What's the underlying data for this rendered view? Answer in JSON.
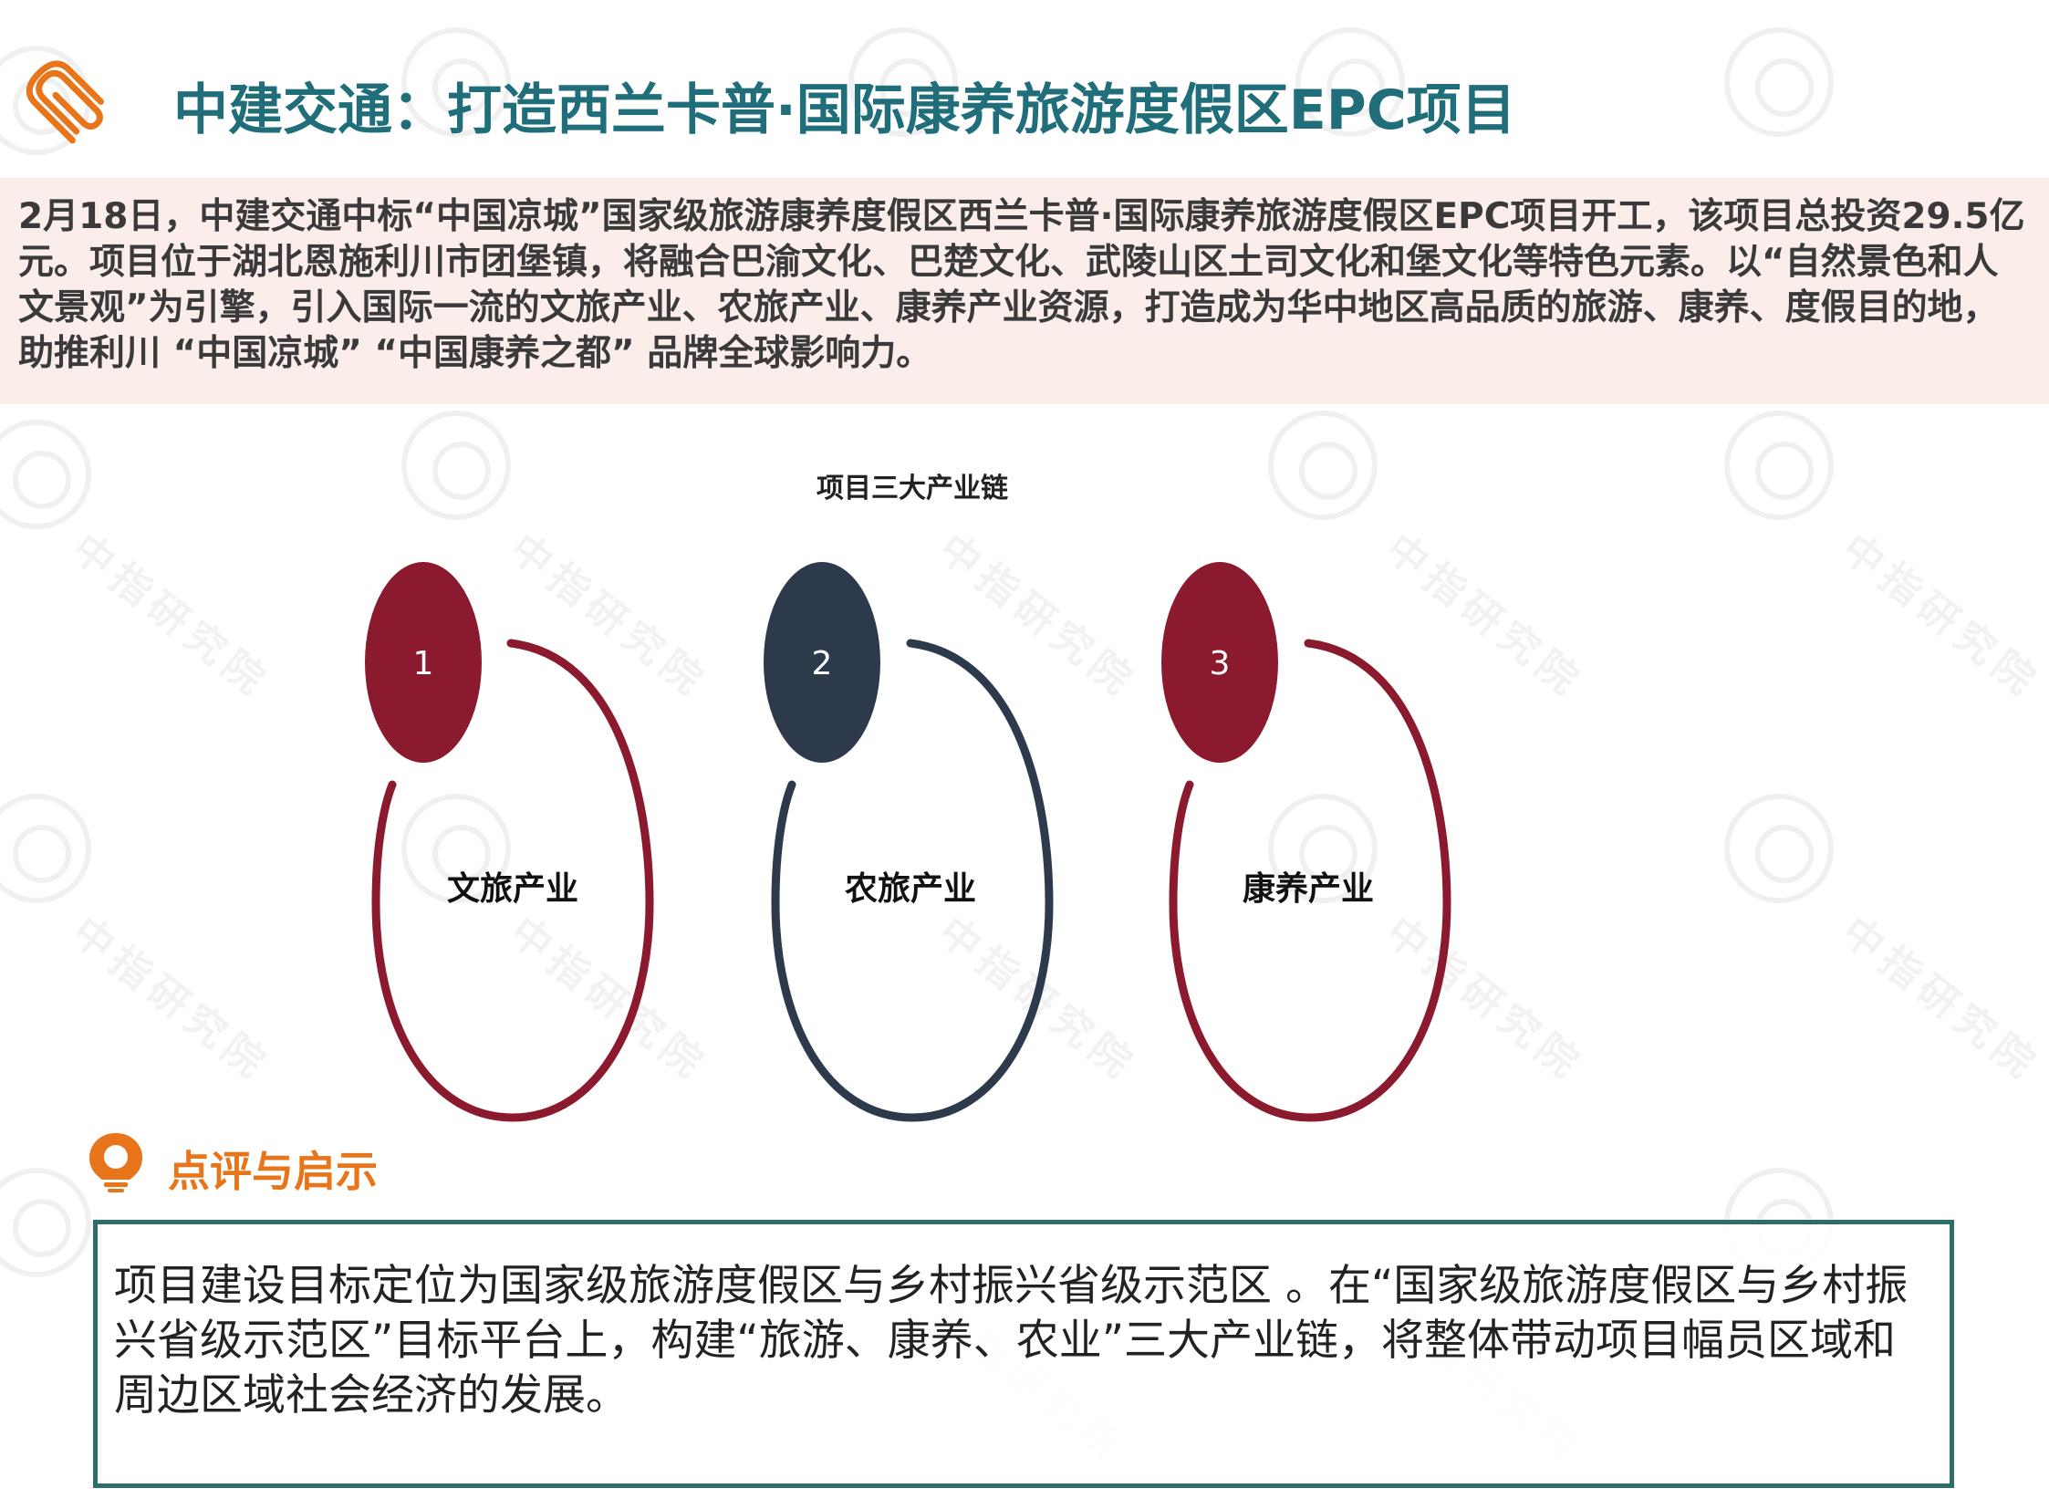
{
  "title": "中建交通：打造西兰卡普·国际康养旅游度假区EPC项目",
  "intro": "2月18日，中建交通中标“中国凉城”国家级旅游康养度假区西兰卡普·国际康养旅游度假区EPC项目开工，该项目总投资29.5亿元。项目位于湖北恩施利川市团堡镇，将融合巴渝文化、巴楚文化、武陵山区土司文化和堡文化等特色元素。以“自然景色和人文景观”为引擎，引入国际一流的文旅产业、农旅产业、康养产业资源，打造成为华中地区高品质的旅游、康养、度假目的地，助推利川 “中国凉城” “中国康养之都” 品牌全球影响力。",
  "chain": {
    "title": "项目三大产业链",
    "items": [
      {
        "number": "1",
        "label": "文旅产业",
        "color": "#8b1a2e"
      },
      {
        "number": "2",
        "label": "农旅产业",
        "color": "#2d3a4b"
      },
      {
        "number": "3",
        "label": "康养产业",
        "color": "#8b1a2e"
      }
    ]
  },
  "comment": {
    "title": "点评与启示",
    "text": "项目建设目标定位为国家级旅游度假区与乡村振兴省级示范区 。在“国家级旅游度假区与乡村振兴省级示范区”目标平台上，构建“旅游、康养、农业”三大产业链，将整体带动项目幅员区域和周边区域社会经济的发展。"
  },
  "colors": {
    "title": "#1f6e7a",
    "accent_orange": "#e8751a",
    "intro_bg": "#faebe8",
    "comment_border": "#2e6e6a"
  },
  "watermark": {
    "text": "中指研究院"
  }
}
